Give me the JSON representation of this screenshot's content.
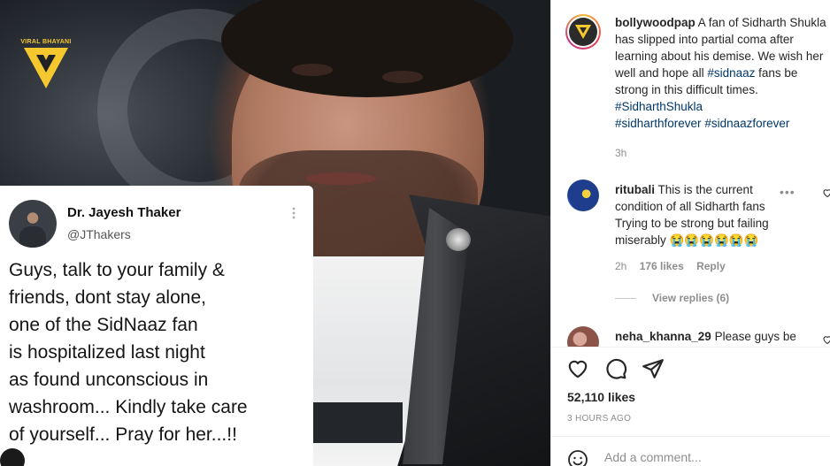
{
  "logo": {
    "text": "VIRAL BHAYANI",
    "brand_color": "#f5c830"
  },
  "tweet": {
    "author": "Dr. Jayesh Thaker",
    "handle": "@JThakers",
    "menu_icon": "vertical-ellipsis-icon",
    "body": "Guys, talk to your family &\nfriends, dont stay alone,\none of the SidNaaz fan\nis hospitalized last night\nas found unconscious in\nwashroom... Kindly take care\nof yourself... Pray for her...!!"
  },
  "caption": {
    "username": "bollywoodpap",
    "text": "A fan of Sidharth Shukla has slipped into partial coma after learning about his demise. We wish her well and hope all",
    "tag_1": "#sidnaaz",
    "text_2": "fans be strong in this difficult times.",
    "tag_2": "#SidharthShukla",
    "tag_3": "#sidharthforever",
    "tag_4": "#sidnaazforever",
    "time": "3h"
  },
  "comments": [
    {
      "username": "ritubali",
      "text": "This is the current condition of all Sidharth fans Trying to be strong but failing miserably",
      "emoji": "😭😭😭😭😭😭",
      "time": "2h",
      "likes": "176 likes",
      "reply_label": "Reply",
      "more_icon": "•••",
      "view_replies": "View replies (6)"
    },
    {
      "username": "neha_khanna_29",
      "text": "Please guys be"
    }
  ],
  "actions": {
    "likes": "52,110 likes",
    "posted": "3 HOURS AGO",
    "comment_placeholder": "Add a comment..."
  },
  "colors": {
    "hashtag": "#00376b",
    "muted": "#8e8e8e",
    "text": "#262626"
  }
}
